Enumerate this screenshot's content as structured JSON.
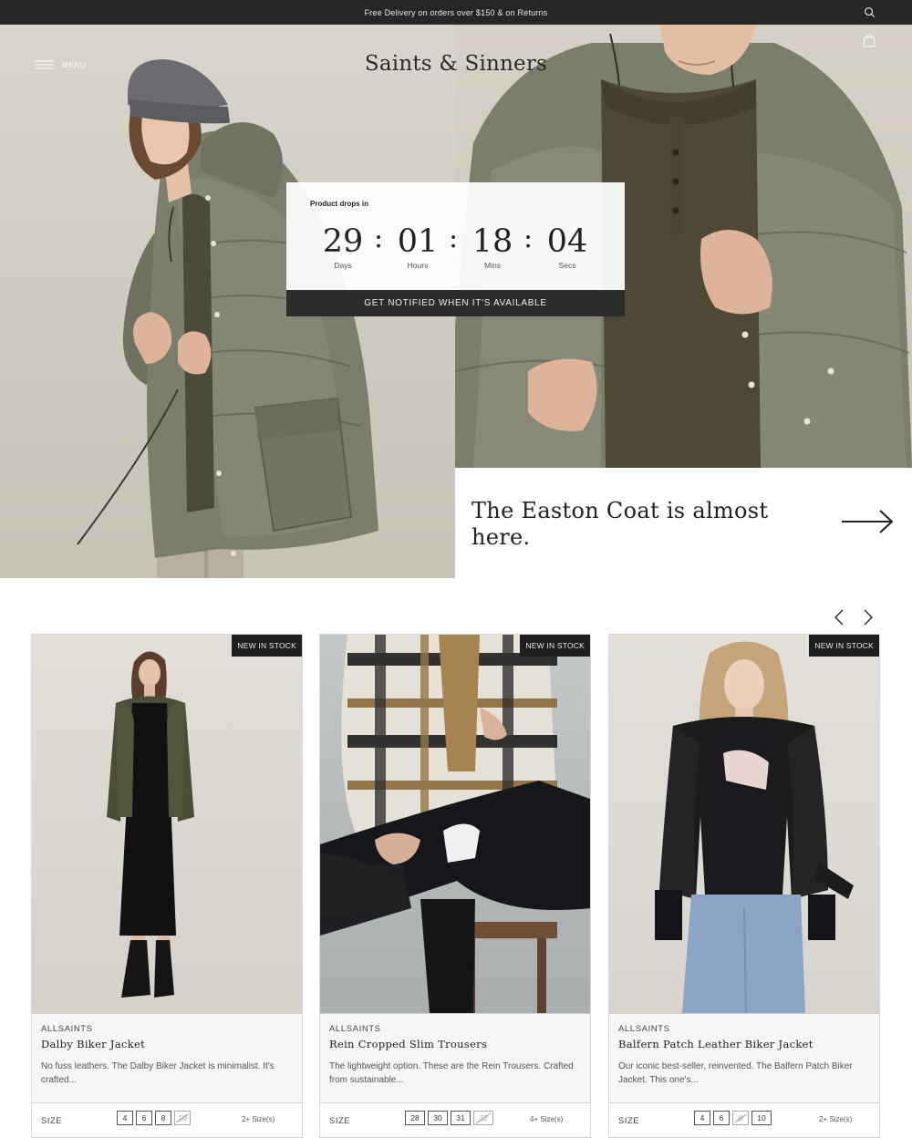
{
  "announcement": "Free Delivery on orders over $150 & on Returns",
  "icons": {
    "search": "search-icon",
    "menu": "hamburger-icon",
    "bag": "shopping-bag-icon",
    "arrow": "arrow-right-icon",
    "prev": "chevron-left-icon",
    "next": "chevron-right-icon"
  },
  "header": {
    "menu_label": "MENU",
    "logo": "Saints & Sinners"
  },
  "countdown": {
    "title": "Product drops in",
    "units": [
      {
        "value": "29",
        "label": "Days"
      },
      {
        "value": "01",
        "label": "Hours"
      },
      {
        "value": "18",
        "label": "Mins"
      },
      {
        "value": "04",
        "label": "Secs"
      }
    ],
    "cta": "GET NOTIFIED WHEN IT'S AVAILABLE"
  },
  "hero": {
    "headline": "The Easton Coat is almost here."
  },
  "products": [
    {
      "badge": "NEW IN STOCK",
      "brand": "ALLSAINTS",
      "name": "Dalby Biker Jacket",
      "description": "No fuss leathers. The Dalby Biker Jacket is minimalist. It's crafted...",
      "size_label": "SIZE",
      "sizes": [
        "4",
        "6",
        "8",
        "10"
      ],
      "unavailable": "10",
      "more_sizes": "2+ Size(s)"
    },
    {
      "badge": "NEW IN STOCK",
      "brand": "ALLSAINTS",
      "name": "Rein Cropped Slim Trousers",
      "description": "The lightweight option. These are the Rein Trousers. Crafted from sustainable...",
      "size_label": "SIZE",
      "sizes": [
        "28",
        "30",
        "31",
        "32"
      ],
      "unavailable": "32",
      "more_sizes": "4+ Size(s)"
    },
    {
      "badge": "NEW IN STOCK",
      "brand": "ALLSAINTS",
      "name": "Balfern Patch Leather Biker Jacket",
      "description": "Our iconic best-seller, reinvented. The Balfern Patch Biker Jacket. This one's...",
      "size_label": "SIZE",
      "sizes": [
        "4",
        "6",
        "8",
        "10"
      ],
      "unavailable": "8",
      "more_sizes": "2+ Size(s)"
    }
  ]
}
